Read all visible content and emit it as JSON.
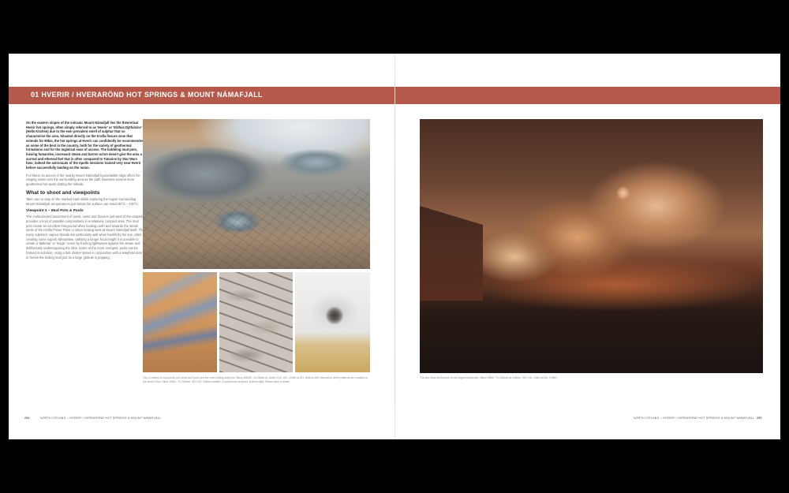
{
  "section": {
    "title": "01  HVERIR / HVERARÖND HOT SPRINGS & MOUNT NÁMAFJALL"
  },
  "left_page": {
    "intro": "On the eastern slopes of the volcanic Mount Námafjall lies the theoretical Hverir hot springs, often simply referred to as 'Hverir' or 'Eldhús Djöfulsins' (Hells Kitchen) due to the ever prevalent smell of sulphur that so characterise the area. Situated directly on the Krafla fissure zone that extends for 90km, the hot springs at Hverir can confidently be recommended as some of the best in the country, both for the variety of geothermal formations and for the logistical ease of access. The bubbling mud pots, hissing fumaroles, incessant steam and barren ochre desert give the area a surreal and ethereal feel that is often compared to Tatooine by Star Wars fans; indeed the astronauts of the Apollo missions trained very near Hverir before successfully landing on the moon.",
    "para2": "For hikers an ascent of the nearby Mount Námafjall hyaloclastite ridge offers far-ranging views over the surrounding area as the path traverses several more geothermal hot spots dotting the hillside.",
    "heading": "What to shoot and viewpoints",
    "para3": "Take care to stay on the marked trails whilst exploring the region surrounding Mount Námafjall; temperatures just below the surface can reach 80°C – 100°C.",
    "subheading": "Viewpoint 1 – Mud Pots & Pools",
    "para4": "The multicoloured assortment of pools, vents and fissures just west of the carpark provides a host of possible compositions in a relatively compact area. The mud pots create an excellent foreground when looking north and towards the steam vents of the Krafla Power Plant or when looking west at Mount Námafjall itself. The many sulphuric vapour islands are particularly well when backlit by the sun, often creating some superb silhouettes. Utilising a longer focal length it is possible to create a 'tabletop' or 'magic' scene by framing lightwaves against the steam and deliberately underexposing the shot. Some of the more energetic pools can be framed in isolation, using a fast shutter speed in conjunction with a telephoto lens to freeze the boiling mud just as a large globule is popping.",
    "caption": "Top: A variety of mud pools, hot vents and pools are the main visiting subjects. Nikon D800E, 16-35mm at 16mm, ISO 100, 1/15th at f/11. Bottom left: Distinctive ochre patterns are created on the desert floor. Nikon D800, 70-200mm, ISO 100. Bottom middle: Cracked mud textures. Bottom right: Steam vent in winter.",
    "footer_page_number": "284",
    "footer_running": "NORTH ICELAND – HVERIR / HVERARÖND HOT SPRINGS & MOUNT NÁMAFJALL"
  },
  "right_page": {
    "caption": "The sun rises behind one of the largest fumaroles. Nikon D800, 70-200mm at 135mm, ISO 100, 1/8th at f/16, 0.6ND",
    "footer_running": "NORTH ICELAND – HVERIR / HVERARÖND HOT SPRINGS & MOUNT NÁMAFJALL",
    "footer_page_number": "285"
  },
  "colors": {
    "banner": "#b5594a",
    "page": "#ffffff",
    "background": "#000000"
  }
}
